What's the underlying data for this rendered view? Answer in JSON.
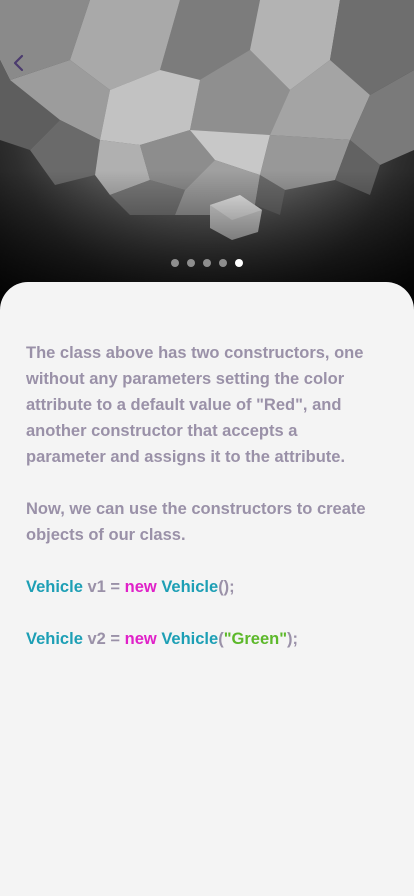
{
  "nav": {
    "back_icon": "chevron-left-icon"
  },
  "pager": {
    "total": 5,
    "active_index": 4
  },
  "colors": {
    "class_name": "#1d9fb5",
    "keyword": "#e021c8",
    "string": "#5cb82a",
    "body_text": "#9a91a8",
    "back_icon": "#4b3b6e"
  },
  "content": {
    "paragraph1": "The class above has two constructors, one without any parameters setting the color attribute to a default value of \"Red\", and another constructor that accepts a parameter and assigns it to the attribute.",
    "paragraph2": "Now, we can use the constructors to create objects of our class.",
    "code_line1": {
      "type": "Vehicle",
      "variable": " v1 = ",
      "keyword": "new",
      "constructor": "Vehicle",
      "args": "();"
    },
    "code_line2": {
      "type": "Vehicle",
      "variable": " v2 = ",
      "keyword": "new",
      "constructor": "Vehicle",
      "open": "(",
      "string": "\"Green\"",
      "close": ");"
    }
  }
}
